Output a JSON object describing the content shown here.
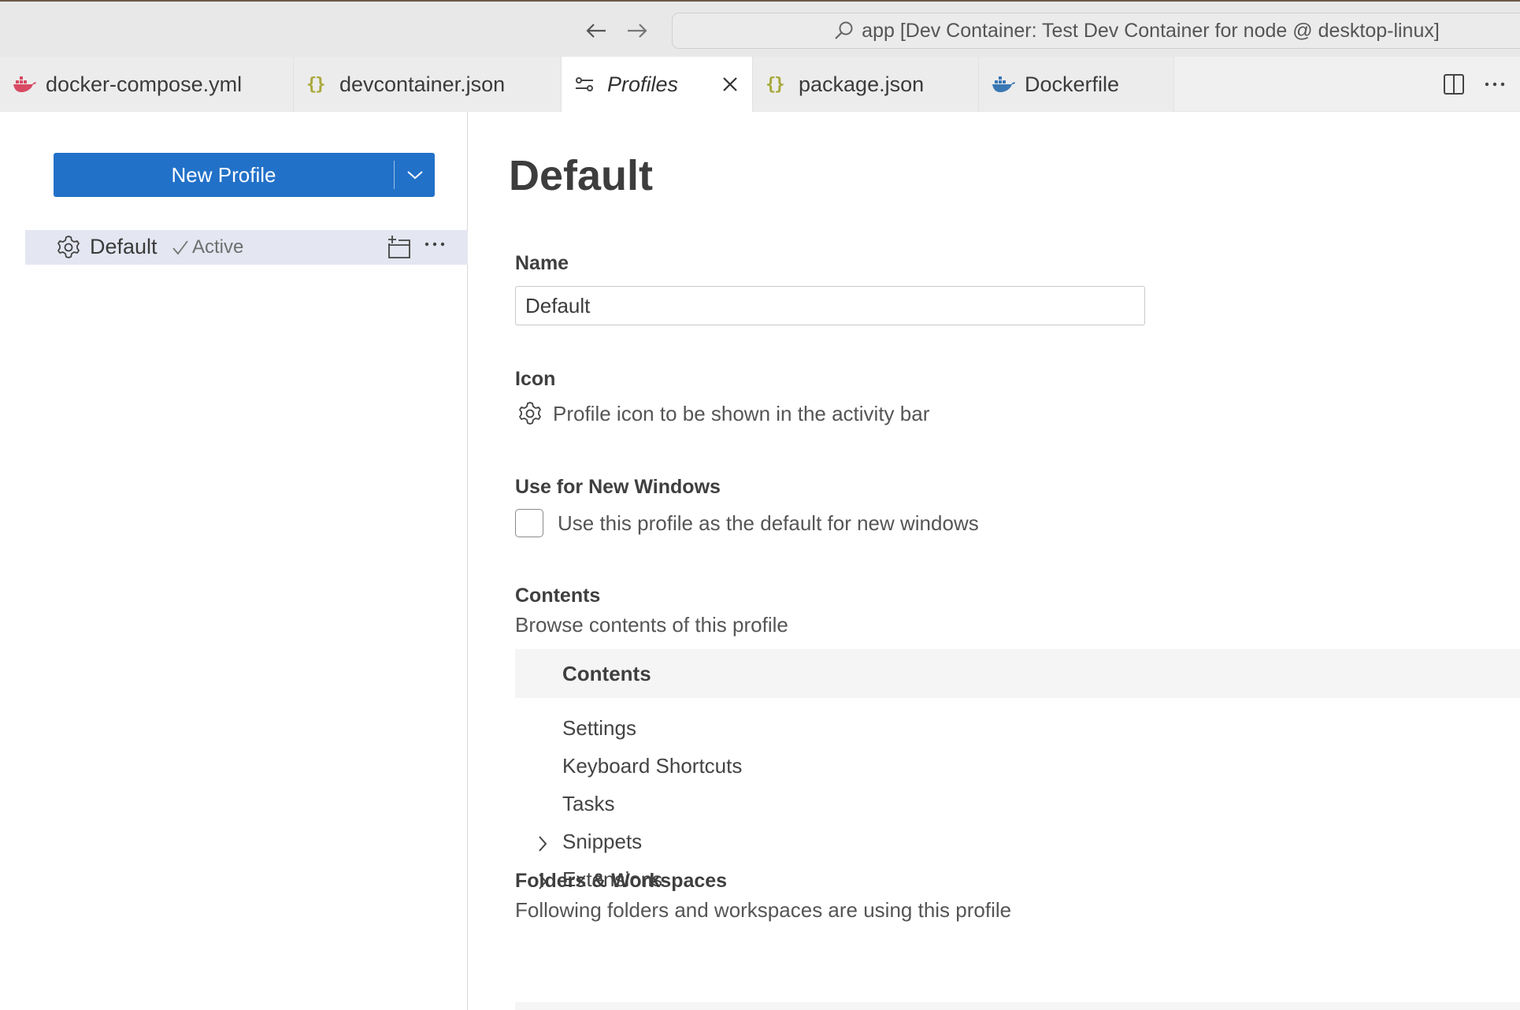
{
  "titlebar": {
    "command_center": "app [Dev Container: Test Dev Container for node @ desktop-linux]"
  },
  "tabs": [
    {
      "label": "docker-compose.yml",
      "icon": "docker-icon",
      "color": "#d84a64"
    },
    {
      "label": "devcontainer.json",
      "icon": "json-braces-icon",
      "color": "#a8a83a"
    },
    {
      "label": "Profiles",
      "icon": "profiles-icon",
      "active": true
    },
    {
      "label": "package.json",
      "icon": "json-braces-icon",
      "color": "#a8a83a"
    },
    {
      "label": "Dockerfile",
      "icon": "docker-icon",
      "color": "#3a78b4"
    }
  ],
  "left": {
    "new_profile_label": "New Profile",
    "profile": {
      "name": "Default",
      "status": "Active"
    }
  },
  "main": {
    "title": "Default",
    "name_label": "Name",
    "name_value": "Default",
    "icon_label": "Icon",
    "icon_desc": "Profile icon to be shown in the activity bar",
    "new_windows_label": "Use for New Windows",
    "new_windows_checkbox": "Use this profile as the default for new windows",
    "new_windows_checked": false,
    "contents_label": "Contents",
    "contents_desc": "Browse contents of this profile",
    "contents_header": "Contents",
    "contents_items": [
      {
        "label": "Settings",
        "expandable": false
      },
      {
        "label": "Keyboard Shortcuts",
        "expandable": false
      },
      {
        "label": "Tasks",
        "expandable": false
      },
      {
        "label": "Snippets",
        "expandable": true
      },
      {
        "label": "Extensions",
        "expandable": true
      }
    ],
    "folders_label": "Folders & Workspaces",
    "folders_desc": "Following folders and workspaces are using this profile"
  },
  "colors": {
    "accent": "#2271c8",
    "selected_row": "#e4e6f1"
  }
}
